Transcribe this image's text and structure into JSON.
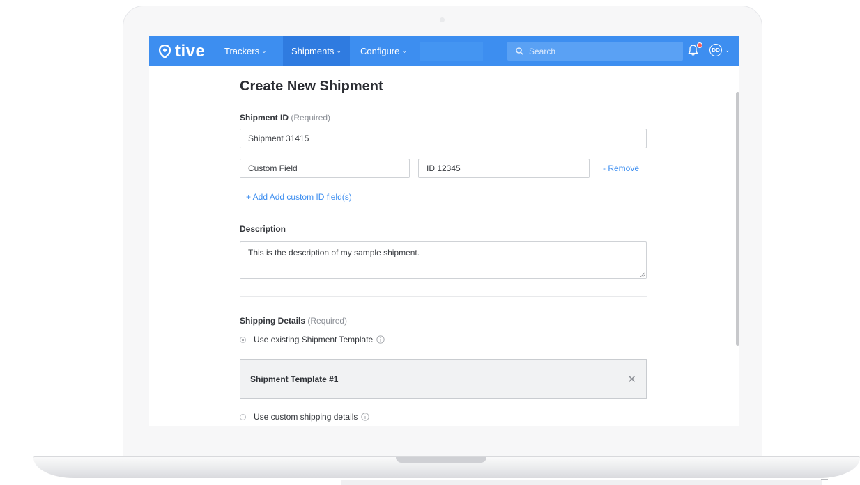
{
  "app": {
    "logo_text": "tive",
    "nav": {
      "trackers": "Trackers",
      "shipments": "Shipments",
      "configure": "Configure"
    },
    "search_placeholder": "Search",
    "avatar_initials": "DD",
    "brand_color": "#3d8ef0",
    "notification_dot_color": "#f25b5b"
  },
  "form": {
    "title": "Create New Shipment",
    "shipment_id_label": "Shipment ID",
    "required_note": "(Required)",
    "shipment_id_value": "Shipment 31415",
    "custom_field_name": "Custom Field",
    "custom_field_value": "ID 12345",
    "remove_link": "- Remove",
    "add_custom_link": "+ Add Add custom ID field(s)",
    "description_label": "Description",
    "description_value": "This is the description of my sample shipment.",
    "shipping_details_label": "Shipping Details",
    "shipping_required_note": "(Required)",
    "option_existing_template": "Use existing Shipment Template",
    "selected_template": "Shipment Template #1",
    "option_custom": "Use custom shipping details"
  }
}
